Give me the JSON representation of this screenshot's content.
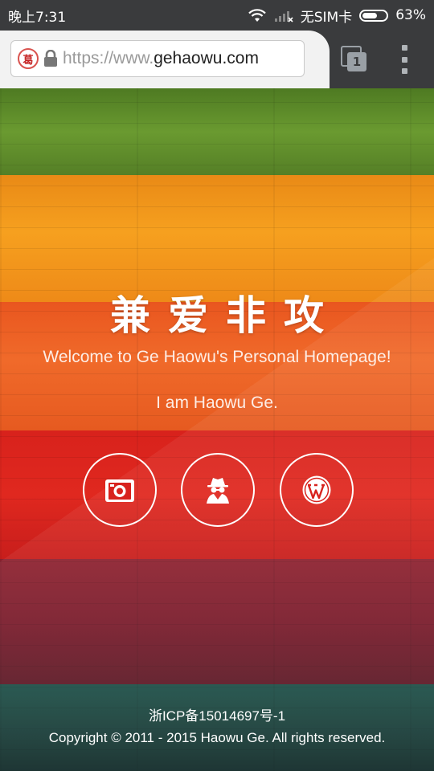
{
  "status_bar": {
    "time": "晚上7:31",
    "carrier": "无SIM卡",
    "battery": "63%",
    "battery_level": 0.63
  },
  "browser": {
    "url_scheme": "https://www.",
    "url_host": "gehaowu.com",
    "favicon_text": "葛",
    "tab_count": "1"
  },
  "page": {
    "title": "兼爱非攻",
    "welcome": "Welcome to Ge Haowu's Personal Homepage!",
    "tagline": "I am Haowu Ge.",
    "links": [
      {
        "icon": "camera-icon"
      },
      {
        "icon": "spy-icon"
      },
      {
        "icon": "wordpress-icon"
      }
    ],
    "footer_icp": "浙ICP备15014697号-1",
    "footer_copyright": "Copyright © 2011 - 2015 Haowu Ge. All rights reserved."
  },
  "colors": {
    "stripe_green": "#5f8a2a",
    "stripe_orange": "#f08a18",
    "stripe_orange_red": "#e8581f",
    "stripe_red": "#d8231e",
    "stripe_maroon": "#7a1f2e",
    "stripe_teal": "#1e4a44"
  }
}
